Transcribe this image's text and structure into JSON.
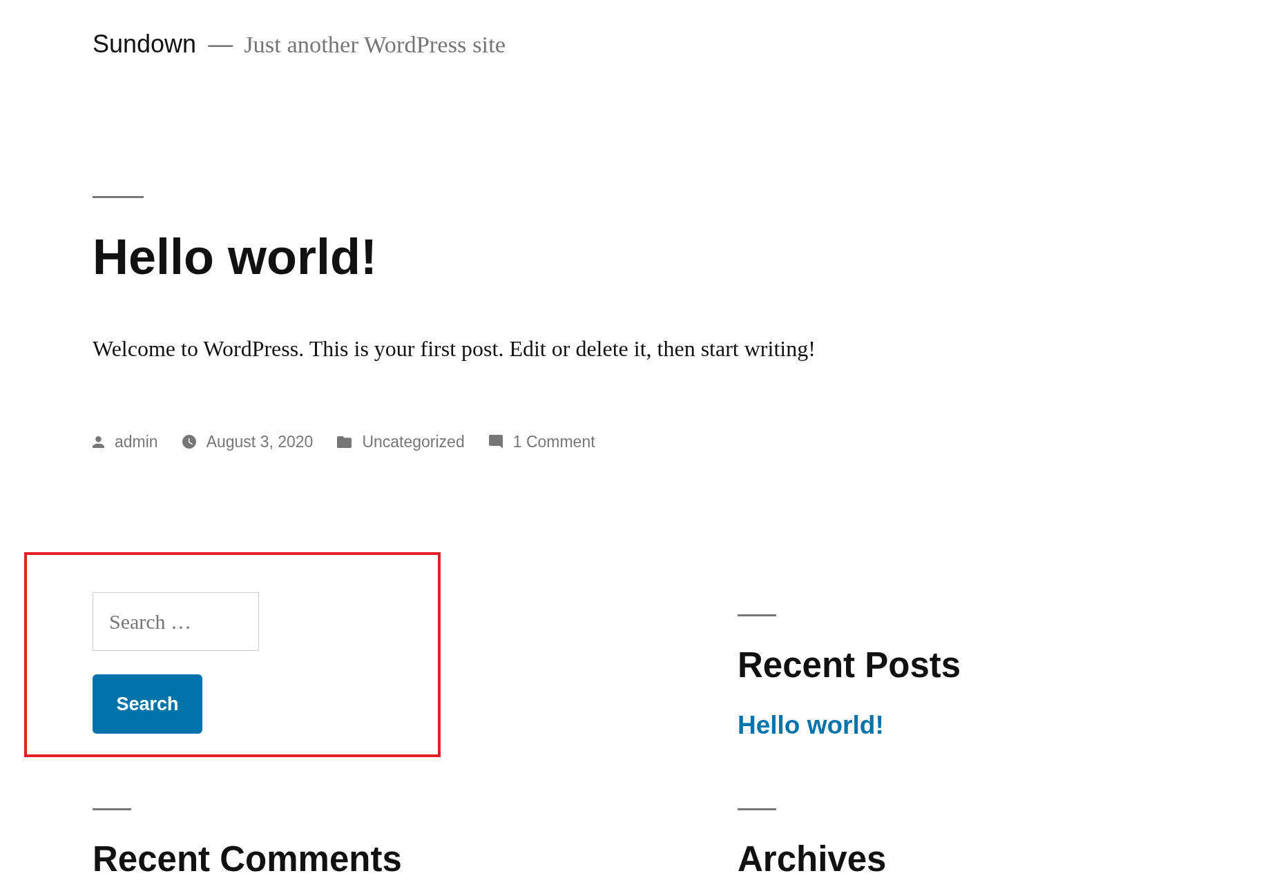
{
  "header": {
    "site_title": "Sundown",
    "separator": "—",
    "tagline": "Just another WordPress site"
  },
  "post": {
    "title": "Hello world!",
    "body": "Welcome to WordPress. This is your first post. Edit or delete it, then start writing!",
    "meta": [
      {
        "kind": "author",
        "text": "admin"
      },
      {
        "kind": "date",
        "text": "August 3, 2020"
      },
      {
        "kind": "category",
        "text": "Uncategorized"
      },
      {
        "kind": "comments",
        "text": "1 Comment"
      }
    ]
  },
  "widgets": [
    {
      "kind": "search",
      "placeholder": "Search …",
      "button": "Search",
      "highlighted": true
    },
    {
      "kind": "list",
      "title": "Recent Posts",
      "items": [
        "Hello world!"
      ]
    },
    {
      "kind": "list",
      "title": "Recent Comments"
    },
    {
      "kind": "list",
      "title": "Archives"
    }
  ]
}
